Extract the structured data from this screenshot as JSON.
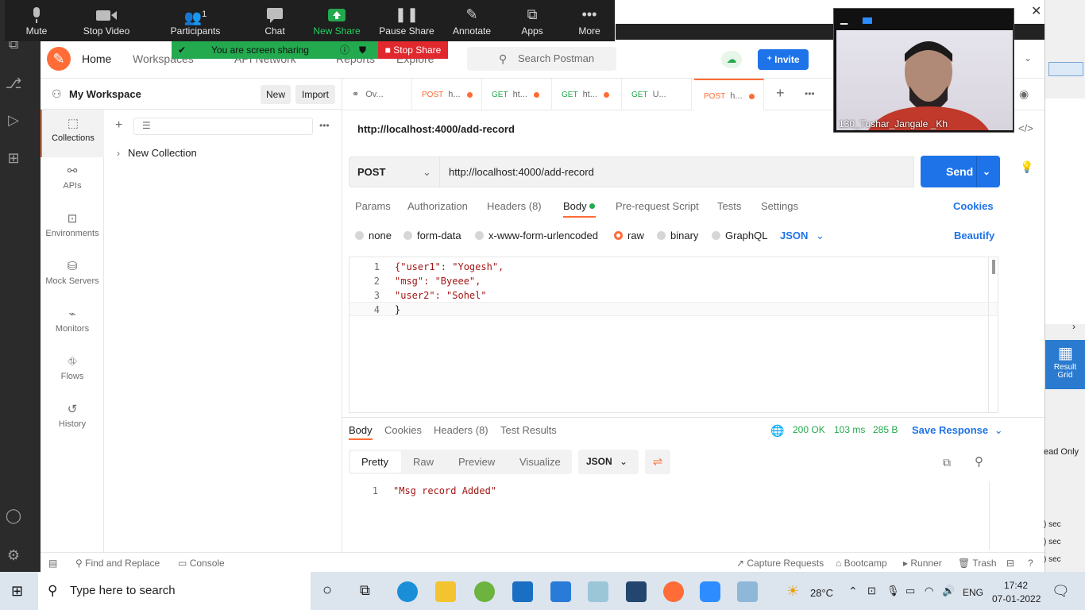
{
  "zoom_toolbar": {
    "mute": "Mute",
    "stop_video": "Stop Video",
    "participants": "Participants",
    "participants_count": "1",
    "chat": "Chat",
    "new_share": "New Share",
    "pause_share": "Pause Share",
    "annotate": "Annotate",
    "apps": "Apps",
    "more": "More",
    "sharing_notice": "You are screen sharing",
    "stop_share": "Stop Share",
    "accent": "#23a94e",
    "stop_color": "#e0282d"
  },
  "video": {
    "participant_name": "130_Tushar_Jangale _Kh"
  },
  "header": {
    "home": "Home",
    "workspaces": "Workspaces",
    "api_network": "API Network",
    "reports": "Reports",
    "explore": "Explore",
    "search_placeholder": "Search Postman",
    "invite": "Invite",
    "brand_color": "#ff6c37",
    "primary_color": "#1f73e8"
  },
  "sidebar": {
    "workspace_name": "My Workspace",
    "new_btn": "New",
    "import_btn": "Import",
    "items": [
      {
        "label": "Collections",
        "icon": "collections-icon"
      },
      {
        "label": "APIs",
        "icon": "apis-icon"
      },
      {
        "label": "Environments",
        "icon": "environments-icon"
      },
      {
        "label": "Mock Servers",
        "icon": "mock-servers-icon"
      },
      {
        "label": "Monitors",
        "icon": "monitors-icon"
      },
      {
        "label": "Flows",
        "icon": "flows-icon"
      },
      {
        "label": "History",
        "icon": "history-icon"
      }
    ],
    "collection": "New Collection"
  },
  "tabs": [
    {
      "method": "",
      "label": "Ov..."
    },
    {
      "method": "POST",
      "label": "h..."
    },
    {
      "method": "GET",
      "label": "ht..."
    },
    {
      "method": "GET",
      "label": "ht..."
    },
    {
      "method": "GET",
      "label": "U..."
    },
    {
      "method": "POST",
      "label": "h..."
    }
  ],
  "request": {
    "title": "http://localhost:4000/add-record",
    "method": "POST",
    "url": "http://localhost:4000/add-record",
    "send": "Send",
    "tabs": {
      "params": "Params",
      "authorization": "Authorization",
      "headers": "Headers (8)",
      "body": "Body",
      "pre_request": "Pre-request Script",
      "tests": "Tests",
      "settings": "Settings",
      "cookies": "Cookies"
    },
    "body_types": {
      "none": "none",
      "form_data": "form-data",
      "urlencoded": "x-www-form-urlencoded",
      "raw": "raw",
      "binary": "binary",
      "graphql": "GraphQL",
      "json": "JSON",
      "beautify": "Beautify"
    },
    "code_lines": [
      {
        "n": "1",
        "text": "{\"user1\": \"Yogesh\","
      },
      {
        "n": "2",
        "text": "\"msg\": \"Byeee\","
      },
      {
        "n": "3",
        "text": "\"user2\": \"Sohel\""
      },
      {
        "n": "4",
        "text": "}"
      }
    ]
  },
  "response": {
    "tabs": {
      "body": "Body",
      "cookies": "Cookies",
      "headers": "Headers (8)",
      "test_results": "Test Results"
    },
    "status": "200 OK",
    "time": "103 ms",
    "size": "285 B",
    "save_response": "Save Response",
    "views": {
      "pretty": "Pretty",
      "raw": "Raw",
      "preview": "Preview",
      "visualize": "Visualize",
      "format": "JSON"
    },
    "line_no": "1",
    "body_text": "\"Msg record Added\""
  },
  "statusbar": {
    "find_replace": "Find and Replace",
    "console": "Console",
    "capture": "Capture Requests",
    "bootcamp": "Bootcamp",
    "runner": "Runner",
    "trash": "Trash"
  },
  "background_window": {
    "result_grid": "Result Grid",
    "read_only": "ead Only",
    "sec1": ") sec",
    "sec2": ") sec",
    "sec3": ") sec"
  },
  "taskbar": {
    "search_placeholder": "Type here to search",
    "temperature": "28°C",
    "language": "ENG",
    "time": "17:42",
    "date": "07-01-2022"
  }
}
